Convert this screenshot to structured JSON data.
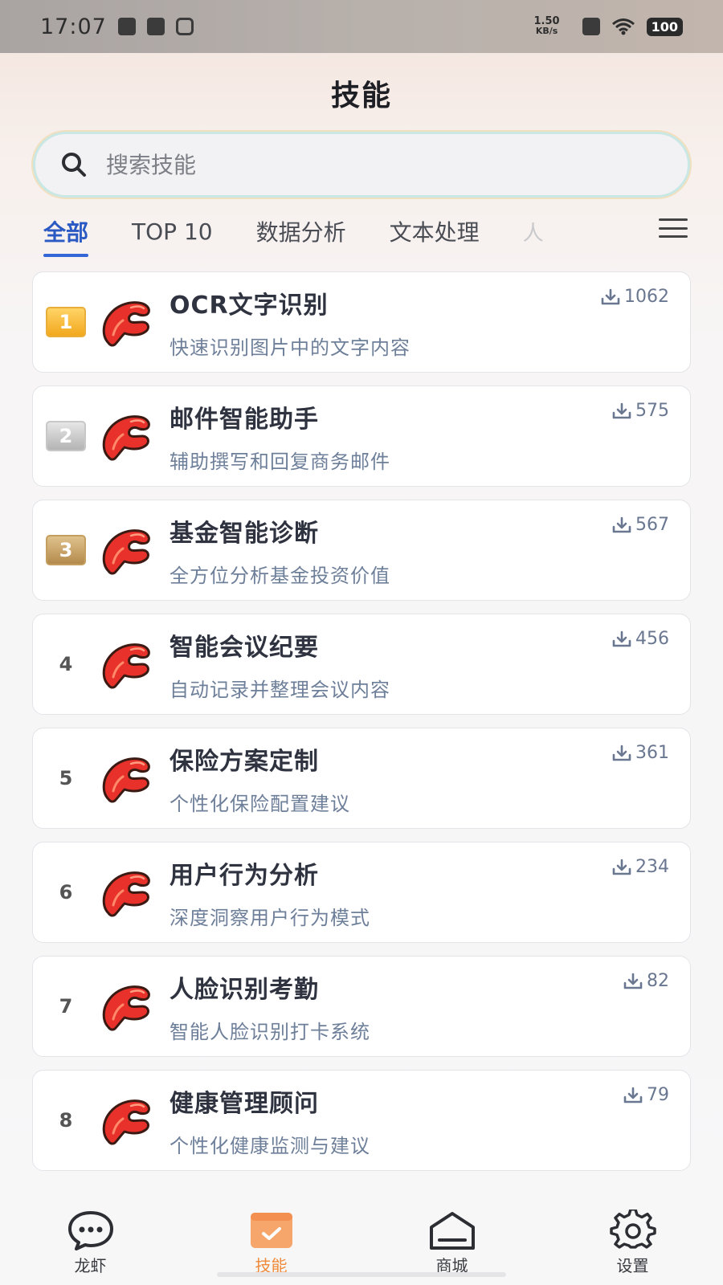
{
  "status_bar": {
    "time": "17:07",
    "net_speed_value": "1.50",
    "net_speed_unit": "KB/s",
    "battery": "100"
  },
  "header": {
    "title": "技能"
  },
  "search": {
    "placeholder": "搜索技能",
    "icon": "search-icon"
  },
  "tabs": [
    {
      "label": "全部",
      "active": true
    },
    {
      "label": "TOP 10"
    },
    {
      "label": "数据分析"
    },
    {
      "label": "文本处理"
    },
    {
      "label": "人"
    }
  ],
  "skills": [
    {
      "rank": "1",
      "title": "OCR文字识别",
      "desc": "快速识别图片中的文字内容",
      "downloads": "1062"
    },
    {
      "rank": "2",
      "title": "邮件智能助手",
      "desc": "辅助撰写和回复商务邮件",
      "downloads": "575"
    },
    {
      "rank": "3",
      "title": "基金智能诊断",
      "desc": "全方位分析基金投资价值",
      "downloads": "567"
    },
    {
      "rank": "4",
      "title": "智能会议纪要",
      "desc": "自动记录并整理会议内容",
      "downloads": "456"
    },
    {
      "rank": "5",
      "title": "保险方案定制",
      "desc": "个性化保险配置建议",
      "downloads": "361"
    },
    {
      "rank": "6",
      "title": "用户行为分析",
      "desc": "深度洞察用户行为模式",
      "downloads": "234"
    },
    {
      "rank": "7",
      "title": "人脸识别考勤",
      "desc": "智能人脸识别打卡系统",
      "downloads": "82"
    },
    {
      "rank": "8",
      "title": "健康管理顾问",
      "desc": "个性化健康监测与建议",
      "downloads": "79"
    }
  ],
  "bottom_nav": [
    {
      "label": "龙虾",
      "icon": "chat-bubble-icon"
    },
    {
      "label": "技能",
      "icon": "skills-card-icon",
      "active": true
    },
    {
      "label": "商城",
      "icon": "store-icon"
    },
    {
      "label": "设置",
      "icon": "gear-icon"
    }
  ],
  "colors": {
    "accent_tab": "#3466d8",
    "nav_active": "#f08a3a",
    "claw_red": "#e8312b"
  }
}
